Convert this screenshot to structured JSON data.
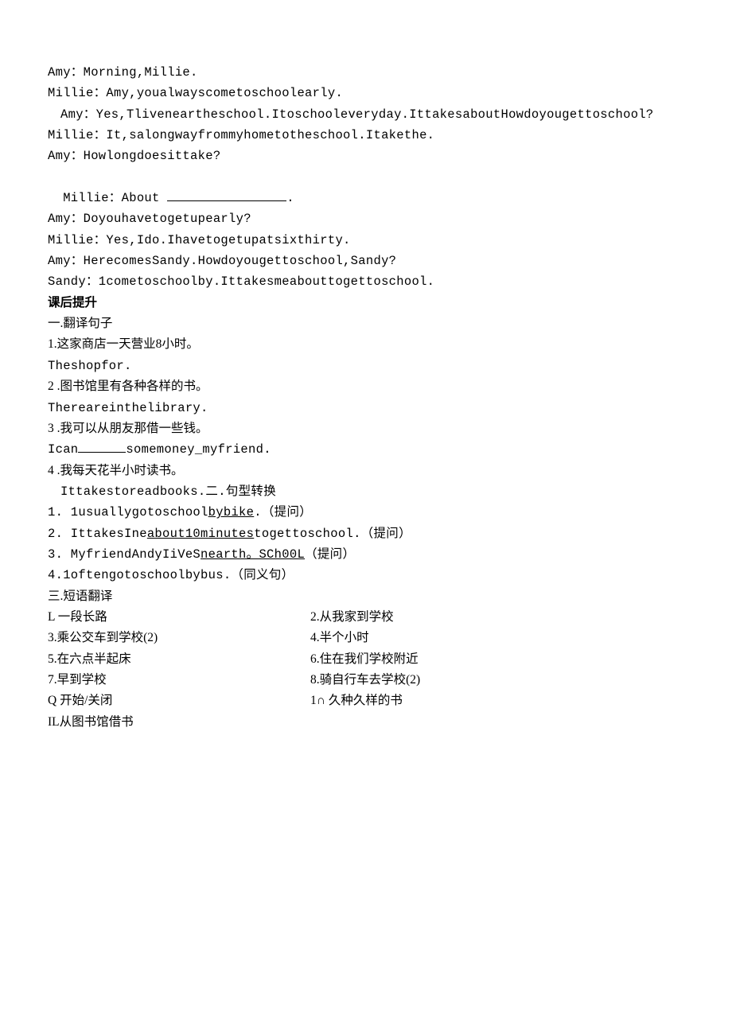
{
  "dialogue": {
    "l1": "Amy：Morning,Millie.",
    "l2": "Millie：Amy,youalwayscometoschoolearly.",
    "l3": "Amy：Yes,Tliveneartheschool.Itoschooleveryday.IttakesaboutHowdoyougettoschool?",
    "l4": "Millie：It,salongwayfrommyhometotheschool.Itakethe.",
    "l5": "Amy：Howlongdoesittake?",
    "l6a": "Millie：About ",
    "l6b": ".",
    "l7": "Amy：Doyouhavetogetupearly?",
    "l8": "Millie：Yes,Ido.Ihavetogetupatsixthirty.",
    "l9": "Amy：HerecomesSandy.Howdoyougettoschool,Sandy?",
    "l10": "Sandy：1cometoschoolby.Ittakesmeabouttogettoschool."
  },
  "aftertitle": "课后提升",
  "section1": {
    "heading": "一.翻译句子",
    "q1": "1.这家商店一天营业8小时。",
    "a1": "Theshopfor.",
    "q2": "2 .图书馆里有各种各样的书。",
    "a2": "Thereareinthelibrary.",
    "q3": "3 .我可以从朋友那借一些钱。",
    "a3a": "Ican",
    "a3b": "somemoney_myfriend.",
    "q4": "4 .我每天花半小时读书。",
    "a4": "Ittakestoreadbooks.二.句型转换"
  },
  "section2": {
    "q1a": "1. 1usuallygotoschool",
    "q1u": "bybike",
    "q1b": ".（提问）",
    "q2a": "2. IttakesIne",
    "q2u": "about10minutes",
    "q2b": "togettoschool.（提问）",
    "q3a": "3. MyfriendAndyIiVeS",
    "q3u": "nearth。SCh00L",
    "q3b": "（提问）",
    "q4": "4.1oftengotoschoolbybus.（同义句）"
  },
  "section3": {
    "heading": "三.短语翻译",
    "rows": [
      {
        "l": "L 一段长路",
        "r": "2.从我家到学校"
      },
      {
        "l": "3.乘公交车到学校(2)",
        "r": "4.半个小时"
      },
      {
        "l": "5.在六点半起床",
        "r": "6.住在我们学校附近"
      },
      {
        "l": "7.早到学校",
        "r": "8.骑自行车去学校(2)"
      },
      {
        "l": "Q 开始/关闭",
        "r": "1∩ 久种久样的书"
      },
      {
        "l": "IL从图书馆借书",
        "r": ""
      }
    ]
  }
}
